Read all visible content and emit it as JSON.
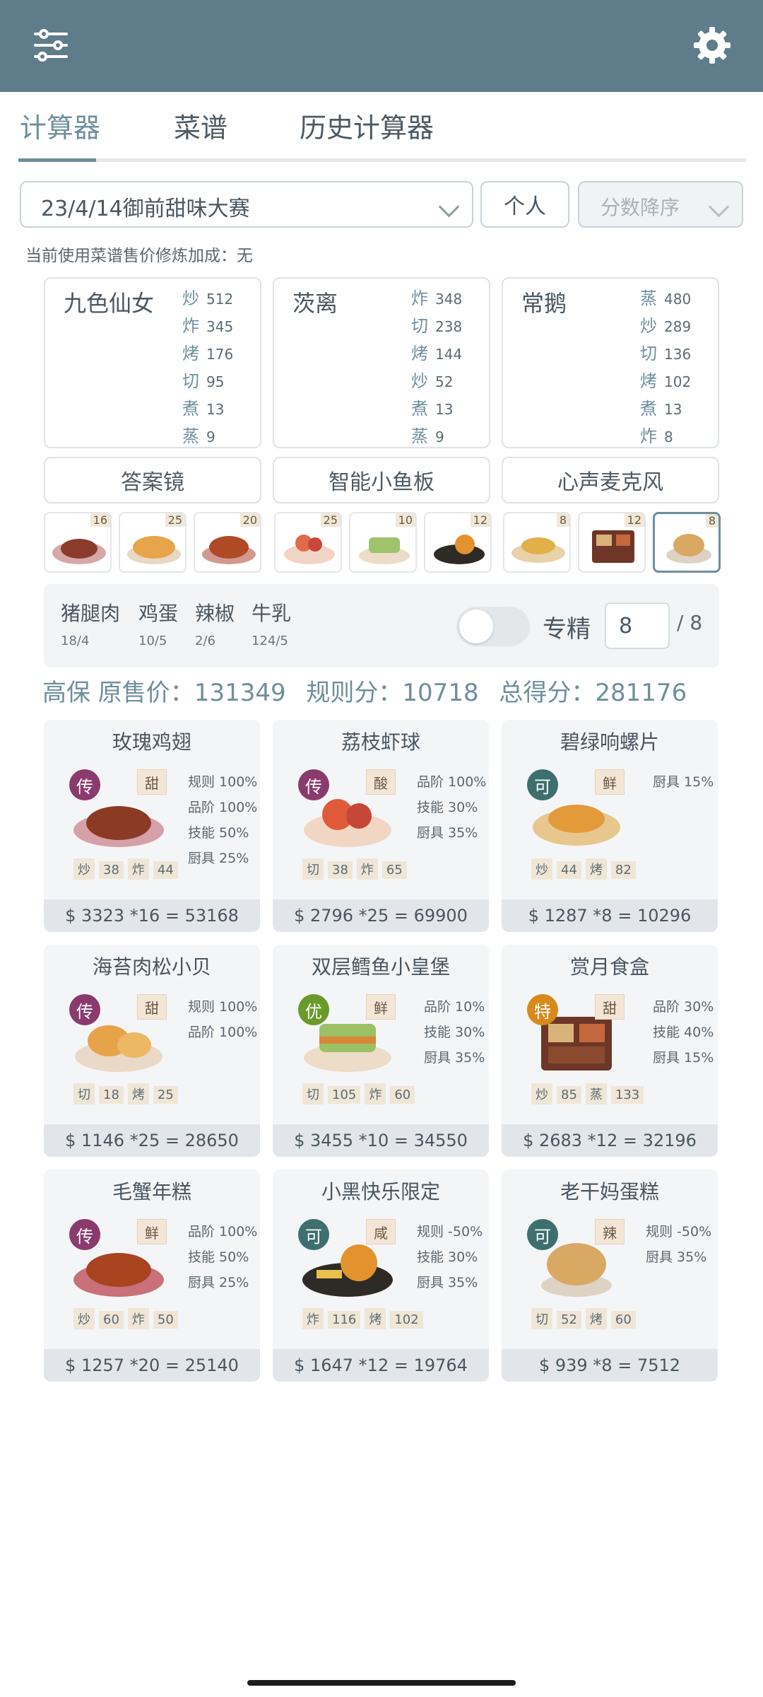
{
  "app_bar": {
    "left_icon": "sliders-icon",
    "right_icon": "gear-icon"
  },
  "tabs": [
    {
      "label": "计算器",
      "active": true
    },
    {
      "label": "菜谱"
    },
    {
      "label": "历史计算器"
    }
  ],
  "controls": {
    "contest": "23/4/14御前甜味大赛",
    "mode": "个人",
    "sort": "分数降序"
  },
  "bonus_line": "当前使用菜谱售价修炼加成：无",
  "chefs": [
    {
      "name": "九色仙女",
      "skills": [
        [
          "炒",
          "512"
        ],
        [
          "炸",
          "345"
        ],
        [
          "烤",
          "176"
        ],
        [
          "切",
          "95"
        ],
        [
          "煮",
          "13"
        ],
        [
          "蒸",
          "9"
        ]
      ]
    },
    {
      "name": "茨离",
      "skills": [
        [
          "炸",
          "348"
        ],
        [
          "切",
          "238"
        ],
        [
          "烤",
          "144"
        ],
        [
          "炒",
          "52"
        ],
        [
          "煮",
          "13"
        ],
        [
          "蒸",
          "9"
        ]
      ]
    },
    {
      "name": "常鹅",
      "skills": [
        [
          "蒸",
          "480"
        ],
        [
          "炒",
          "289"
        ],
        [
          "切",
          "136"
        ],
        [
          "烤",
          "102"
        ],
        [
          "煮",
          "13"
        ],
        [
          "炸",
          "8"
        ]
      ]
    }
  ],
  "tools": [
    "答案镜",
    "智能小鱼板",
    "心声麦克风"
  ],
  "thumbs": [
    "16",
    "25",
    "20",
    "25",
    "10",
    "12",
    "8",
    "12",
    "8"
  ],
  "ingredients": [
    {
      "name": "猪腿肉",
      "qty": "18/4"
    },
    {
      "name": "鸡蛋",
      "qty": "10/5"
    },
    {
      "name": "辣椒",
      "qty": "2/6"
    },
    {
      "name": "牛乳",
      "qty": "124/5"
    }
  ],
  "specialize": {
    "label": "专精",
    "value": "8",
    "max": "/ 8"
  },
  "summary": {
    "a": "高保 原售价：131349",
    "b": "规则分：10718",
    "c": "总得分：281176"
  },
  "recipes": [
    {
      "name": "玫瑰鸡翅",
      "rank": "传",
      "taste": "甜",
      "bonus": [
        "规则 100%",
        "品阶 100%",
        "技能 50%",
        "厨具 25%"
      ],
      "skills": [
        [
          "炒",
          "38"
        ],
        [
          "炸",
          "44"
        ]
      ],
      "price": "$ 3323 *16 = 53168",
      "rank_color": "#8b3a6e"
    },
    {
      "name": "荔枝虾球",
      "rank": "传",
      "taste": "酸",
      "bonus": [
        "品阶 100%",
        "技能 30%",
        "厨具 35%"
      ],
      "skills": [
        [
          "切",
          "38"
        ],
        [
          "炸",
          "65"
        ]
      ],
      "price": "$ 2796 *25 = 69900",
      "rank_color": "#8b3a6e"
    },
    {
      "name": "碧绿响螺片",
      "rank": "可",
      "taste": "鲜",
      "bonus": [
        "厨具 15%"
      ],
      "skills": [
        [
          "炒",
          "44"
        ],
        [
          "烤",
          "82"
        ]
      ],
      "price": "$ 1287 *8 = 10296",
      "rank_color": "#3d6f6f"
    },
    {
      "name": "海苔肉松小贝",
      "rank": "传",
      "taste": "甜",
      "bonus": [
        "规则 100%",
        "品阶 100%"
      ],
      "skills": [
        [
          "切",
          "18"
        ],
        [
          "烤",
          "25"
        ]
      ],
      "price": "$ 1146 *25 = 28650",
      "rank_color": "#8b3a6e"
    },
    {
      "name": "双层鳕鱼小皇堡",
      "rank": "优",
      "taste": "鲜",
      "bonus": [
        "品阶 10%",
        "技能 30%",
        "厨具 35%"
      ],
      "skills": [
        [
          "切",
          "105"
        ],
        [
          "炸",
          "60"
        ]
      ],
      "price": "$ 3455 *10 = 34550",
      "rank_color": "#6a9a2a"
    },
    {
      "name": "赏月食盒",
      "rank": "特",
      "taste": "甜",
      "bonus": [
        "品阶 30%",
        "技能 40%",
        "厨具 15%"
      ],
      "skills": [
        [
          "炒",
          "85"
        ],
        [
          "蒸",
          "133"
        ]
      ],
      "price": "$ 2683 *12 = 32196",
      "rank_color": "#d8891c"
    },
    {
      "name": "毛蟹年糕",
      "rank": "传",
      "taste": "鲜",
      "bonus": [
        "品阶 100%",
        "技能 50%",
        "厨具 25%"
      ],
      "skills": [
        [
          "炒",
          "60"
        ],
        [
          "炸",
          "50"
        ]
      ],
      "price": "$ 1257 *20 = 25140",
      "rank_color": "#8b3a6e"
    },
    {
      "name": "小黑快乐限定",
      "rank": "可",
      "taste": "咸",
      "bonus": [
        "规则 -50%",
        "技能 30%",
        "厨具 35%"
      ],
      "skills": [
        [
          "炸",
          "116"
        ],
        [
          "烤",
          "102"
        ]
      ],
      "price": "$ 1647 *12 = 19764",
      "rank_color": "#3d6f6f"
    },
    {
      "name": "老干妈蛋糕",
      "rank": "可",
      "taste": "辣",
      "bonus": [
        "规则 -50%",
        "厨具 35%"
      ],
      "skills": [
        [
          "切",
          "52"
        ],
        [
          "烤",
          "60"
        ]
      ],
      "price": "$ 939 *8 = 7512",
      "rank_color": "#3d6f6f"
    }
  ]
}
